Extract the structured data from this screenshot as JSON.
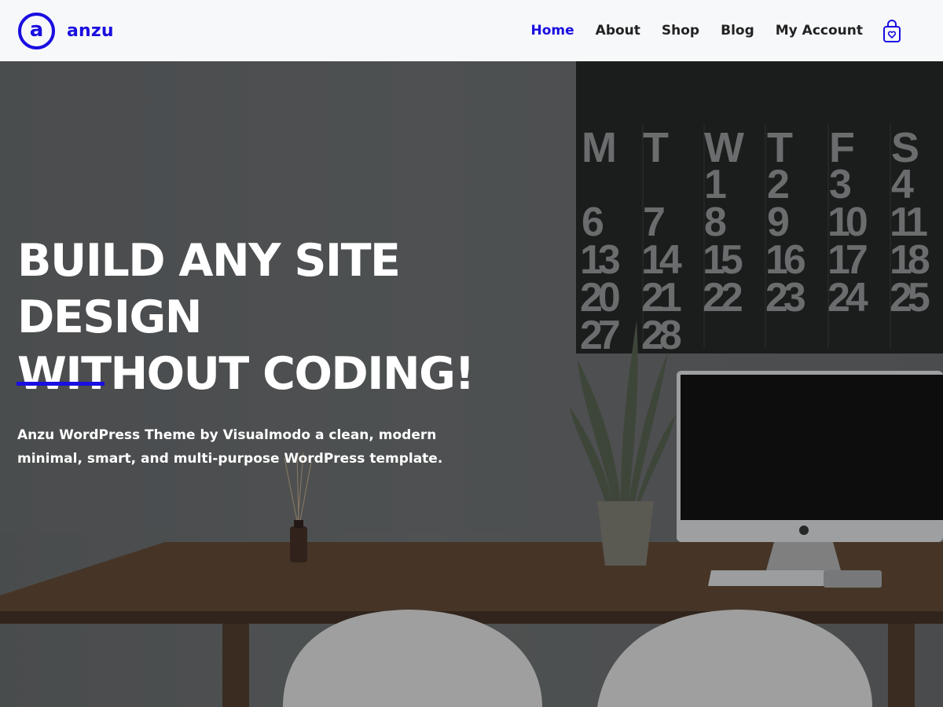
{
  "brand": {
    "mark": "a",
    "name": "anzu"
  },
  "nav": {
    "items": [
      {
        "label": "Home",
        "active": true
      },
      {
        "label": "About",
        "active": false
      },
      {
        "label": "Shop",
        "active": false
      },
      {
        "label": "Blog",
        "active": false
      },
      {
        "label": "My Account",
        "active": false
      }
    ],
    "cart_icon": "shopping-bag-heart-icon"
  },
  "hero": {
    "headline_line1": "BUILD ANY SITE DESIGN",
    "headline_line2": "WITHOUT CODING!",
    "description_line1": "Anzu WordPress Theme by Visualmodo a clean, modern",
    "description_line2": "minimal, smart, and multi-purpose WordPress template."
  },
  "calendar": {
    "weekdays": [
      "M",
      "T",
      "W",
      "T",
      "F",
      "S"
    ],
    "weeks": [
      [
        "",
        "",
        "1",
        "2",
        "3",
        "4"
      ],
      [
        "6",
        "7",
        "8",
        "9",
        "10",
        "11"
      ],
      [
        "13",
        "14",
        "15",
        "16",
        "17",
        "18"
      ],
      [
        "20",
        "21",
        "22",
        "23",
        "24",
        "25"
      ],
      [
        "27",
        "28",
        "",
        "",
        "",
        ""
      ]
    ]
  },
  "colors": {
    "accent": "#1a0ee0",
    "header_bg": "#f7f8fa",
    "nav_text": "#222222",
    "hero_text": "#ffffff"
  }
}
